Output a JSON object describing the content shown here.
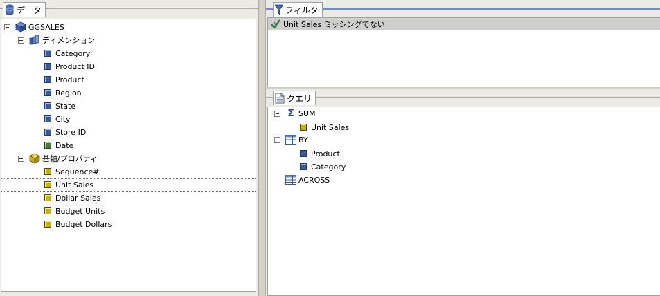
{
  "data_panel": {
    "tab_label": "データ",
    "root": "GGSALES",
    "dimensions_label": "ディメンション",
    "dimension_fields": [
      "Category",
      "Product ID",
      "Product",
      "Region",
      "State",
      "City",
      "Store ID",
      "Date"
    ],
    "measures_label": "基軸/プロパティ",
    "measure_fields": [
      "Sequence#",
      "Unit Sales",
      "Dollar Sales",
      "Budget Units",
      "Budget Dollars"
    ],
    "selected_field": "Unit Sales"
  },
  "filter_panel": {
    "tab_label": "フィルタ",
    "filter_text": "Unit Sales ミッシングでない"
  },
  "query_panel": {
    "tab_label": "クエリ",
    "sum_label": "SUM",
    "sum_fields": [
      "Unit Sales"
    ],
    "by_label": "BY",
    "by_fields": [
      "Product",
      "Category"
    ],
    "across_label": "ACROSS"
  },
  "colors": {
    "accent_blue": "#6a8ccf",
    "selection_gray": "#cfcfcf"
  },
  "icons": {
    "data_tab": "database-icon",
    "filter_tab": "funnel-icon",
    "query_tab": "document-icon",
    "root": "cube-icon",
    "dimensions": "dimension-stack-icon",
    "measures": "measure-box-icon",
    "sum": "sigma-icon",
    "by": "grid-icon",
    "across": "grid-icon",
    "filter_row": "check-icon"
  }
}
